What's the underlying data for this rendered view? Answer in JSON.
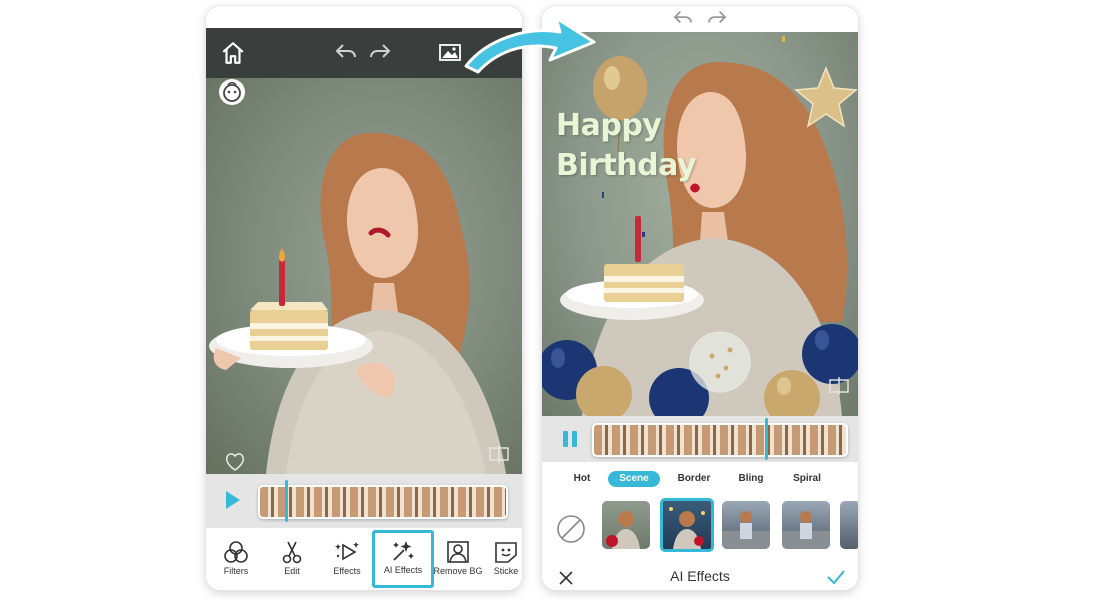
{
  "left_screen": {
    "toolbar": [
      {
        "label": "Filters",
        "icon": "filters-icon"
      },
      {
        "label": "Edit",
        "icon": "scissors-icon"
      },
      {
        "label": "Effects",
        "icon": "effects-icon"
      },
      {
        "label": "AI Effects",
        "icon": "ai-effects-icon",
        "active": true
      },
      {
        "label": "Remove BG",
        "icon": "remove-bg-icon"
      },
      {
        "label": "Sticke",
        "icon": "sticker-icon"
      }
    ],
    "playhead_position": 0.11
  },
  "right_screen": {
    "overlay_text": {
      "line1": "Happy",
      "line2": "Birthday"
    },
    "tabs": [
      {
        "label": "Hot"
      },
      {
        "label": "Scene",
        "active": true
      },
      {
        "label": "Border"
      },
      {
        "label": "Bling"
      },
      {
        "label": "Spiral"
      }
    ],
    "bottom_title": "AI Effects",
    "playhead_position": 0.68
  },
  "colors": {
    "accent": "#36b9d8",
    "overlay_text": "#e9f6d6"
  }
}
